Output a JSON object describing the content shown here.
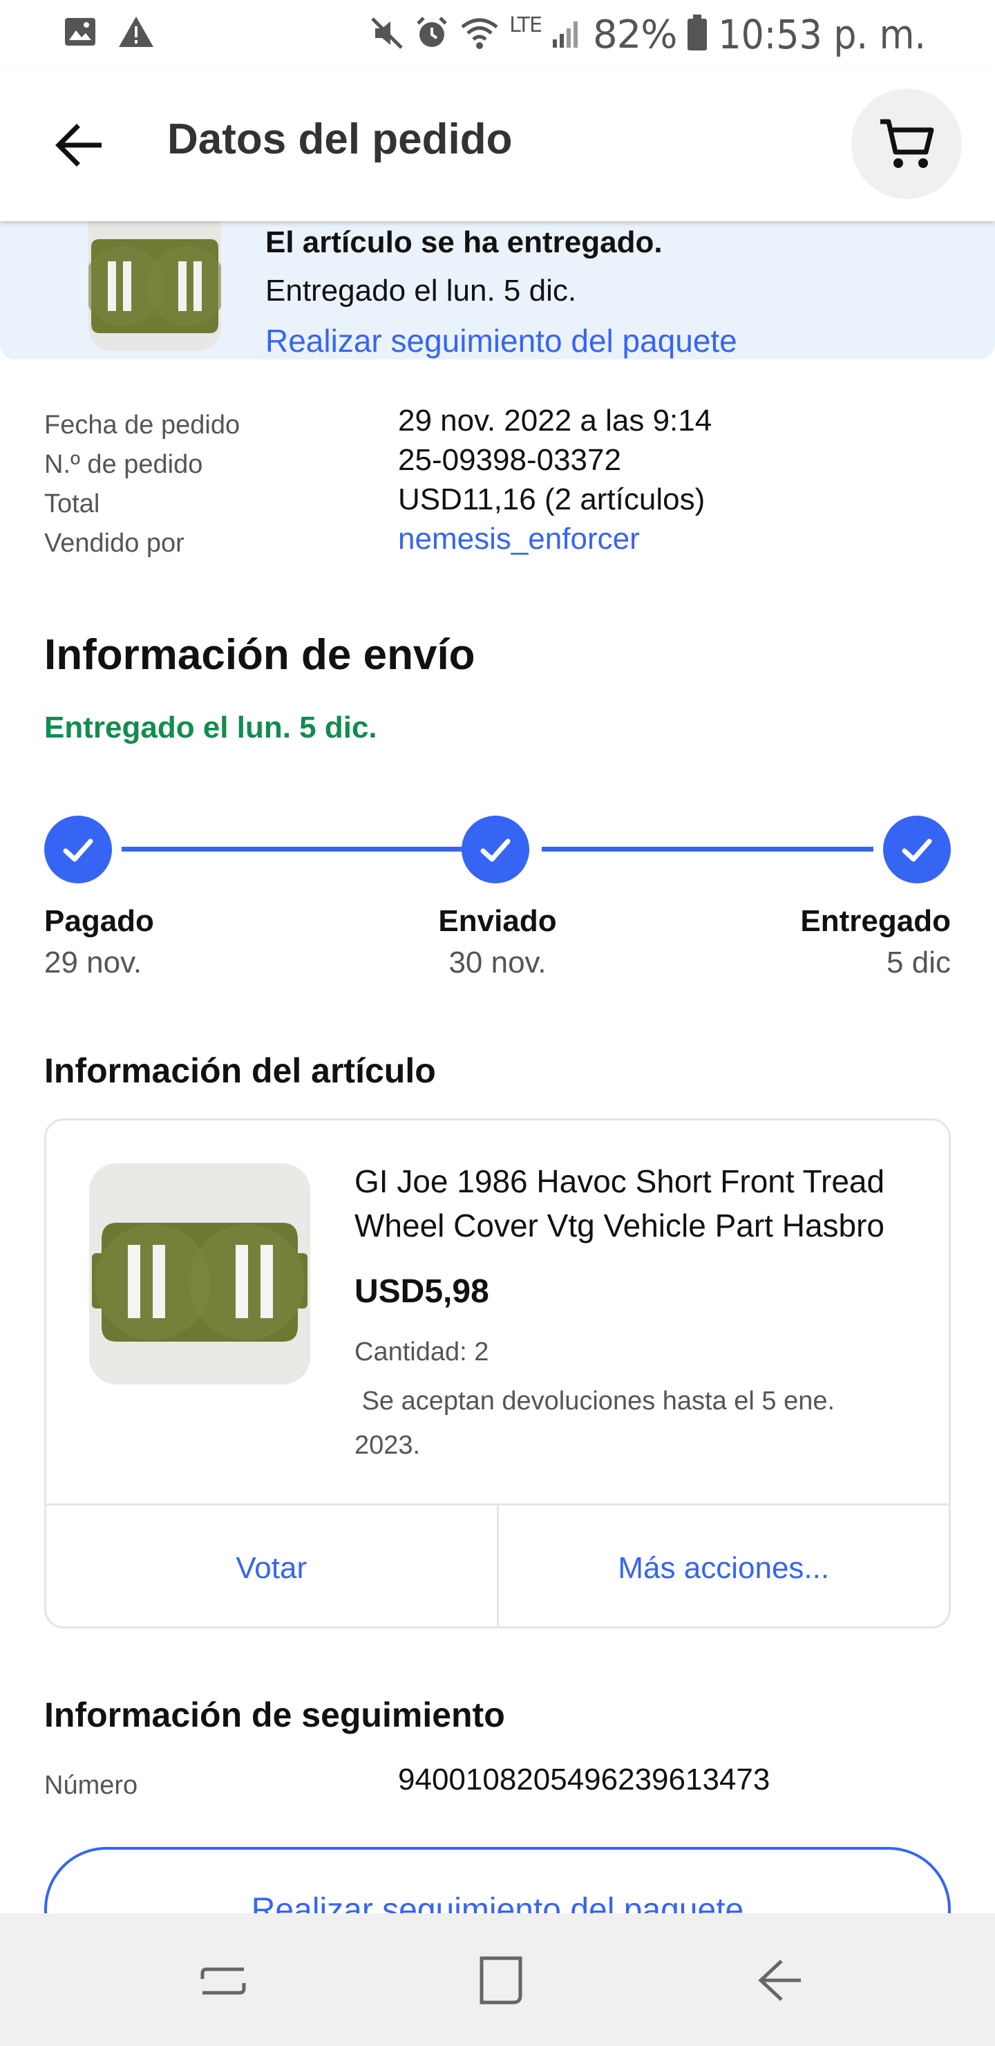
{
  "status_bar": {
    "battery": "82%",
    "time": "10:53 p. m.",
    "network": "LTE"
  },
  "toolbar": {
    "title": "Datos del pedido",
    "back_icon": "arrow-left-icon",
    "cart_icon": "shopping-cart-icon"
  },
  "banner": {
    "status": "El artículo se ha entregado.",
    "delivered_on": "Entregado el lun. 5 dic.",
    "track_link": "Realizar seguimiento del paquete"
  },
  "order": {
    "rows": [
      {
        "label": "Fecha de pedido",
        "value": "29 nov. 2022 a las 9:14"
      },
      {
        "label": "N.º de pedido",
        "value": "25-09398-03372"
      },
      {
        "label": "Total",
        "value": "USD11,16 (2 artículos)"
      },
      {
        "label": "Vendido por",
        "value": "nemesis_enforcer"
      }
    ]
  },
  "shipping": {
    "heading": "Información de envío",
    "status": "Entregado el lun. 5 dic.",
    "steps": [
      {
        "label": "Pagado",
        "date": "29 nov."
      },
      {
        "label": "Enviado",
        "date": "30 nov."
      },
      {
        "label": "Entregado",
        "date": "5 dic"
      }
    ]
  },
  "item": {
    "heading": "Información del artículo",
    "title": "GI Joe 1986 Havoc Short Front Tread Wheel Cover Vtg Vehicle Part Hasbro",
    "price": "USD5,98",
    "quantity": "Cantidad: 2",
    "returns": " Se aceptan devoluciones hasta el 5 ene. 2023.",
    "actions": [
      "Votar",
      "Más acciones..."
    ]
  },
  "tracking": {
    "heading": "Información de seguimiento",
    "number_label": "Número",
    "number": "9400108205496239613473",
    "button": "Realizar seguimiento del paquete"
  },
  "colors": {
    "accent": "#3665f3",
    "success": "#118c4f",
    "banner_bg": "#eaf2fb"
  }
}
